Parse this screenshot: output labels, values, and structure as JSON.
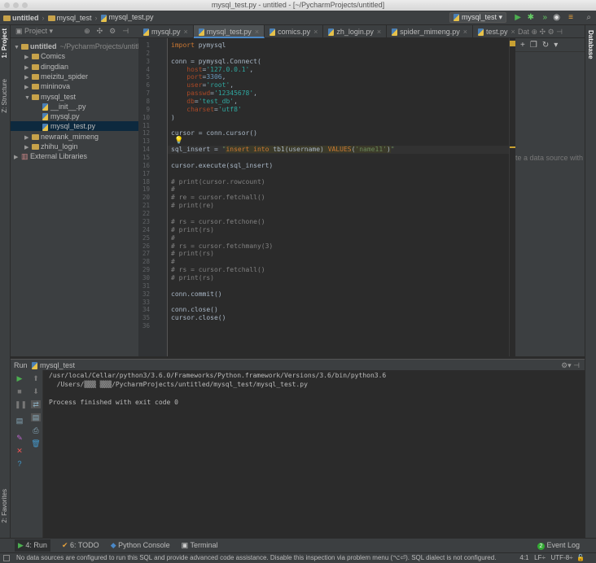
{
  "window": {
    "title": "mysql_test.py - untitled - [~/PycharmProjects/untitled]"
  },
  "breadcrumb": [
    "untitled",
    "mysql_test",
    "mysql_test.py"
  ],
  "run_config": "mysql_test",
  "project_panel": {
    "label": "Project",
    "tree": [
      {
        "label": "untitled",
        "extra": "~/PycharmProjects/untitled",
        "type": "folder",
        "open": true,
        "indent": 0
      },
      {
        "label": "Comics",
        "type": "folder",
        "indent": 1
      },
      {
        "label": "dingdian",
        "type": "folder",
        "indent": 1
      },
      {
        "label": "meizitu_spider",
        "type": "folder",
        "indent": 1
      },
      {
        "label": "mininova",
        "type": "folder",
        "indent": 1
      },
      {
        "label": "mysql_test",
        "type": "folder",
        "open": true,
        "indent": 1
      },
      {
        "label": "__init__.py",
        "type": "py",
        "indent": 2
      },
      {
        "label": "mysql.py",
        "type": "py",
        "indent": 2
      },
      {
        "label": "mysql_test.py",
        "type": "py",
        "indent": 2,
        "selected": true
      },
      {
        "label": "newrank_mimeng",
        "type": "folder",
        "indent": 1
      },
      {
        "label": "zhihu_login",
        "type": "folder",
        "indent": 1
      },
      {
        "label": "External Libraries",
        "type": "lib",
        "indent": 0
      }
    ]
  },
  "editor_tabs": [
    {
      "label": "mysql.py"
    },
    {
      "label": "mysql_test.py",
      "active": true
    },
    {
      "label": "comics.py"
    },
    {
      "label": "zh_login.py"
    },
    {
      "label": "spider_mimeng.py"
    },
    {
      "label": "test.py"
    }
  ],
  "hidden_tabs_count": "4",
  "code_lines": [
    [
      [
        "import",
        "kw"
      ],
      [
        " pymysql",
        ""
      ]
    ],
    [],
    [
      [
        "conn = pymysql.Connect(",
        ""
      ]
    ],
    [
      [
        "    ",
        ""
      ],
      [
        "host",
        "par"
      ],
      [
        "=",
        ""
      ],
      [
        "'127.0.0.1'",
        "strc"
      ],
      [
        ",",
        ""
      ]
    ],
    [
      [
        "    ",
        ""
      ],
      [
        "port",
        "par"
      ],
      [
        "=",
        ""
      ],
      [
        "3306",
        "num"
      ],
      [
        ",",
        ""
      ]
    ],
    [
      [
        "    ",
        ""
      ],
      [
        "user",
        "par"
      ],
      [
        "=",
        ""
      ],
      [
        "'root'",
        "strc"
      ],
      [
        ",",
        ""
      ]
    ],
    [
      [
        "    ",
        ""
      ],
      [
        "passwd",
        "par"
      ],
      [
        "=",
        ""
      ],
      [
        "'12345678'",
        "strc"
      ],
      [
        ",",
        ""
      ]
    ],
    [
      [
        "    ",
        ""
      ],
      [
        "db",
        "par"
      ],
      [
        "=",
        ""
      ],
      [
        "'test_db'",
        "strc"
      ],
      [
        ",",
        ""
      ]
    ],
    [
      [
        "    ",
        ""
      ],
      [
        "charset",
        "par"
      ],
      [
        "=",
        ""
      ],
      [
        "'utf8'",
        "strc"
      ]
    ],
    [
      [
        ")",
        ""
      ]
    ],
    [],
    [
      [
        "cursor = conn.cursor()",
        ""
      ]
    ],
    [],
    [
      [
        "sql_insert = ",
        ""
      ],
      [
        "\"",
        "str"
      ],
      [
        "insert into",
        "sq"
      ],
      [
        " tb1(username) ",
        "sqp"
      ],
      [
        "VALUES",
        "sq"
      ],
      [
        "(",
        "sqp"
      ],
      [
        "'name11'",
        "sqs"
      ],
      [
        ")",
        "sqp"
      ],
      [
        "\"",
        "str"
      ]
    ],
    [],
    [
      [
        "cursor.execute(sql_insert)",
        ""
      ]
    ],
    [],
    [
      [
        "# print(cursor.rowcount)",
        "cm"
      ]
    ],
    [
      [
        "#",
        "cm"
      ]
    ],
    [
      [
        "# re = cursor.fetchall()",
        "cm"
      ]
    ],
    [
      [
        "# print(re)",
        "cm"
      ]
    ],
    [],
    [
      [
        "# rs = cursor.fetchone()",
        "cm"
      ]
    ],
    [
      [
        "# print(rs)",
        "cm"
      ]
    ],
    [
      [
        "#",
        "cm"
      ]
    ],
    [
      [
        "# rs = cursor.fetchmany(3)",
        "cm"
      ]
    ],
    [
      [
        "# print(rs)",
        "cm"
      ]
    ],
    [
      [
        "#",
        "cm"
      ]
    ],
    [
      [
        "# rs = cursor.fetchall()",
        "cm"
      ]
    ],
    [
      [
        "# print(rs)",
        "cm"
      ]
    ],
    [],
    [
      [
        "conn.commit()",
        ""
      ]
    ],
    [],
    [
      [
        "conn.close()",
        ""
      ]
    ],
    [
      [
        "cursor.close()",
        ""
      ]
    ],
    []
  ],
  "database_panel": {
    "header": "Dat",
    "tab_label": "Database",
    "message": "te a data source with"
  },
  "left_tabs": {
    "project": "1: Project",
    "structure": "Z: Structure",
    "favorites": "2: Favorites"
  },
  "run_panel": {
    "label": "Run",
    "config": "mysql_test",
    "output": [
      "/usr/local/Cellar/python3/3.6.0/Frameworks/Python.framework/Versions/3.6/bin/python3.6",
      "  /Users/▒▒▒ ▒▒▒/PycharmProjects/untitled/mysql_test/mysql_test.py",
      "",
      "Process finished with exit code 0"
    ]
  },
  "bottom_tabs": [
    {
      "label": "4: Run",
      "active": true
    },
    {
      "label": "6: TODO"
    },
    {
      "label": "Python Console"
    },
    {
      "label": "Terminal"
    }
  ],
  "event_log": {
    "count": "2",
    "label": "Event Log"
  },
  "status": {
    "message": "No data sources are configured to run this SQL and provide advanced code assistance. Disable this inspection via problem menu (⌥⏎). SQL dialect is not configured.",
    "position": "4:1",
    "line_sep": "LF÷",
    "encoding": "UTF-8÷"
  },
  "colors": {
    "accent": "#4a88c7",
    "run_green": "#4caf50",
    "keyword": "#cc7832",
    "string": "#6a8759"
  }
}
